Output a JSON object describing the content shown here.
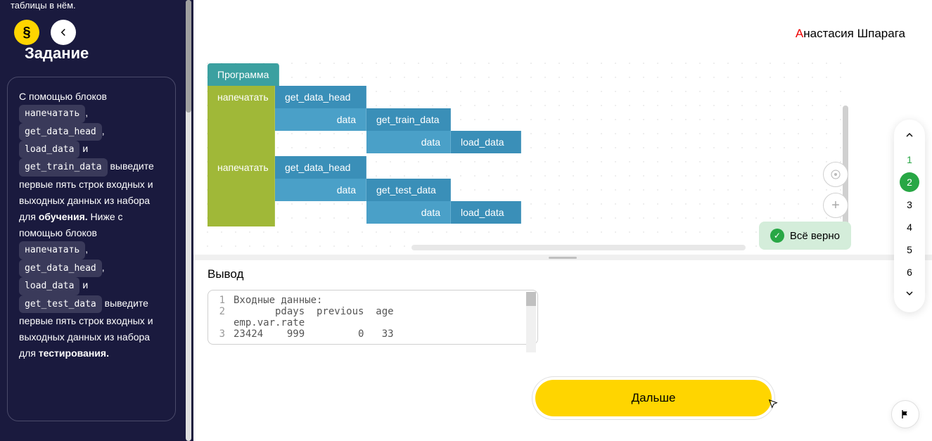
{
  "sidebar": {
    "top_text": "таблицы в нём.",
    "heading": "Задание",
    "task": {
      "intro1": "С помощью блоков ",
      "chip_print": "напечатать",
      "chip_head": "get_data_head",
      "chip_load": "load_data",
      "and": " и ",
      "chip_train": "get_train_data",
      "text1": " выведите первые пять строк входных и выходных данных из набора для ",
      "bold1": "обучения.",
      "text2": " Ниже с помощью блоков ",
      "chip_test": "get_test_data",
      "text3": " выведите первые пять строк входных и выходных данных из набора для ",
      "bold2": "тестирования."
    }
  },
  "user": {
    "first": "А",
    "rest": "настасия Шпарага"
  },
  "blocks": {
    "program": "Программа",
    "print": "напечатать",
    "get_data_head": "get_data_head",
    "data": "data",
    "get_train_data": "get_train_data",
    "get_test_data": "get_test_data",
    "load_data": "load_data"
  },
  "correct": "Всё верно",
  "output": {
    "title": "Вывод",
    "l1": "Входные данные:",
    "l2": "       pdays  previous  age  ",
    "l2b": "emp.var.rate",
    "l3": "23424    999         0   33"
  },
  "next_button": "Дальше",
  "steps": [
    "1",
    "2",
    "3",
    "4",
    "5",
    "6"
  ]
}
